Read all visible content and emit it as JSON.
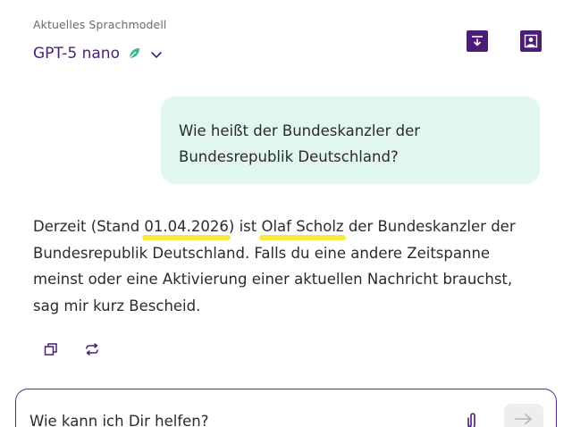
{
  "header": {
    "caption": "Aktuelles Sprachmodell",
    "model_name": "GPT-5 nano",
    "icons": {
      "leaf": "leaf-icon",
      "chevron": "chevron-down-icon",
      "save": "download-box-icon",
      "profile": "profile-icon"
    }
  },
  "conversation": {
    "user_line1": "Wie heißt der Bundeskanzler der",
    "user_line2": "Bundesrepublik Deutschland?",
    "assistant": {
      "t1": "Derzeit (Stand ",
      "date": "01.04.2026",
      "t2": ") ist ",
      "name": "Olaf Scholz",
      "t3": " der Bundeskanzler der Bundesrepublik Deutschland. Falls du eine andere Zeitspanne meinst oder eine Aktivierung einer aktuellen Nachricht brauchst, sag mir kurz Bescheid."
    }
  },
  "composer": {
    "placeholder": "Wie kann ich Dir helfen?"
  },
  "colors": {
    "brand": "#4b1d77",
    "user_bubble": "#e2f6f1",
    "highlight": "#f4ea2e",
    "leaf": "#3fb58a"
  }
}
